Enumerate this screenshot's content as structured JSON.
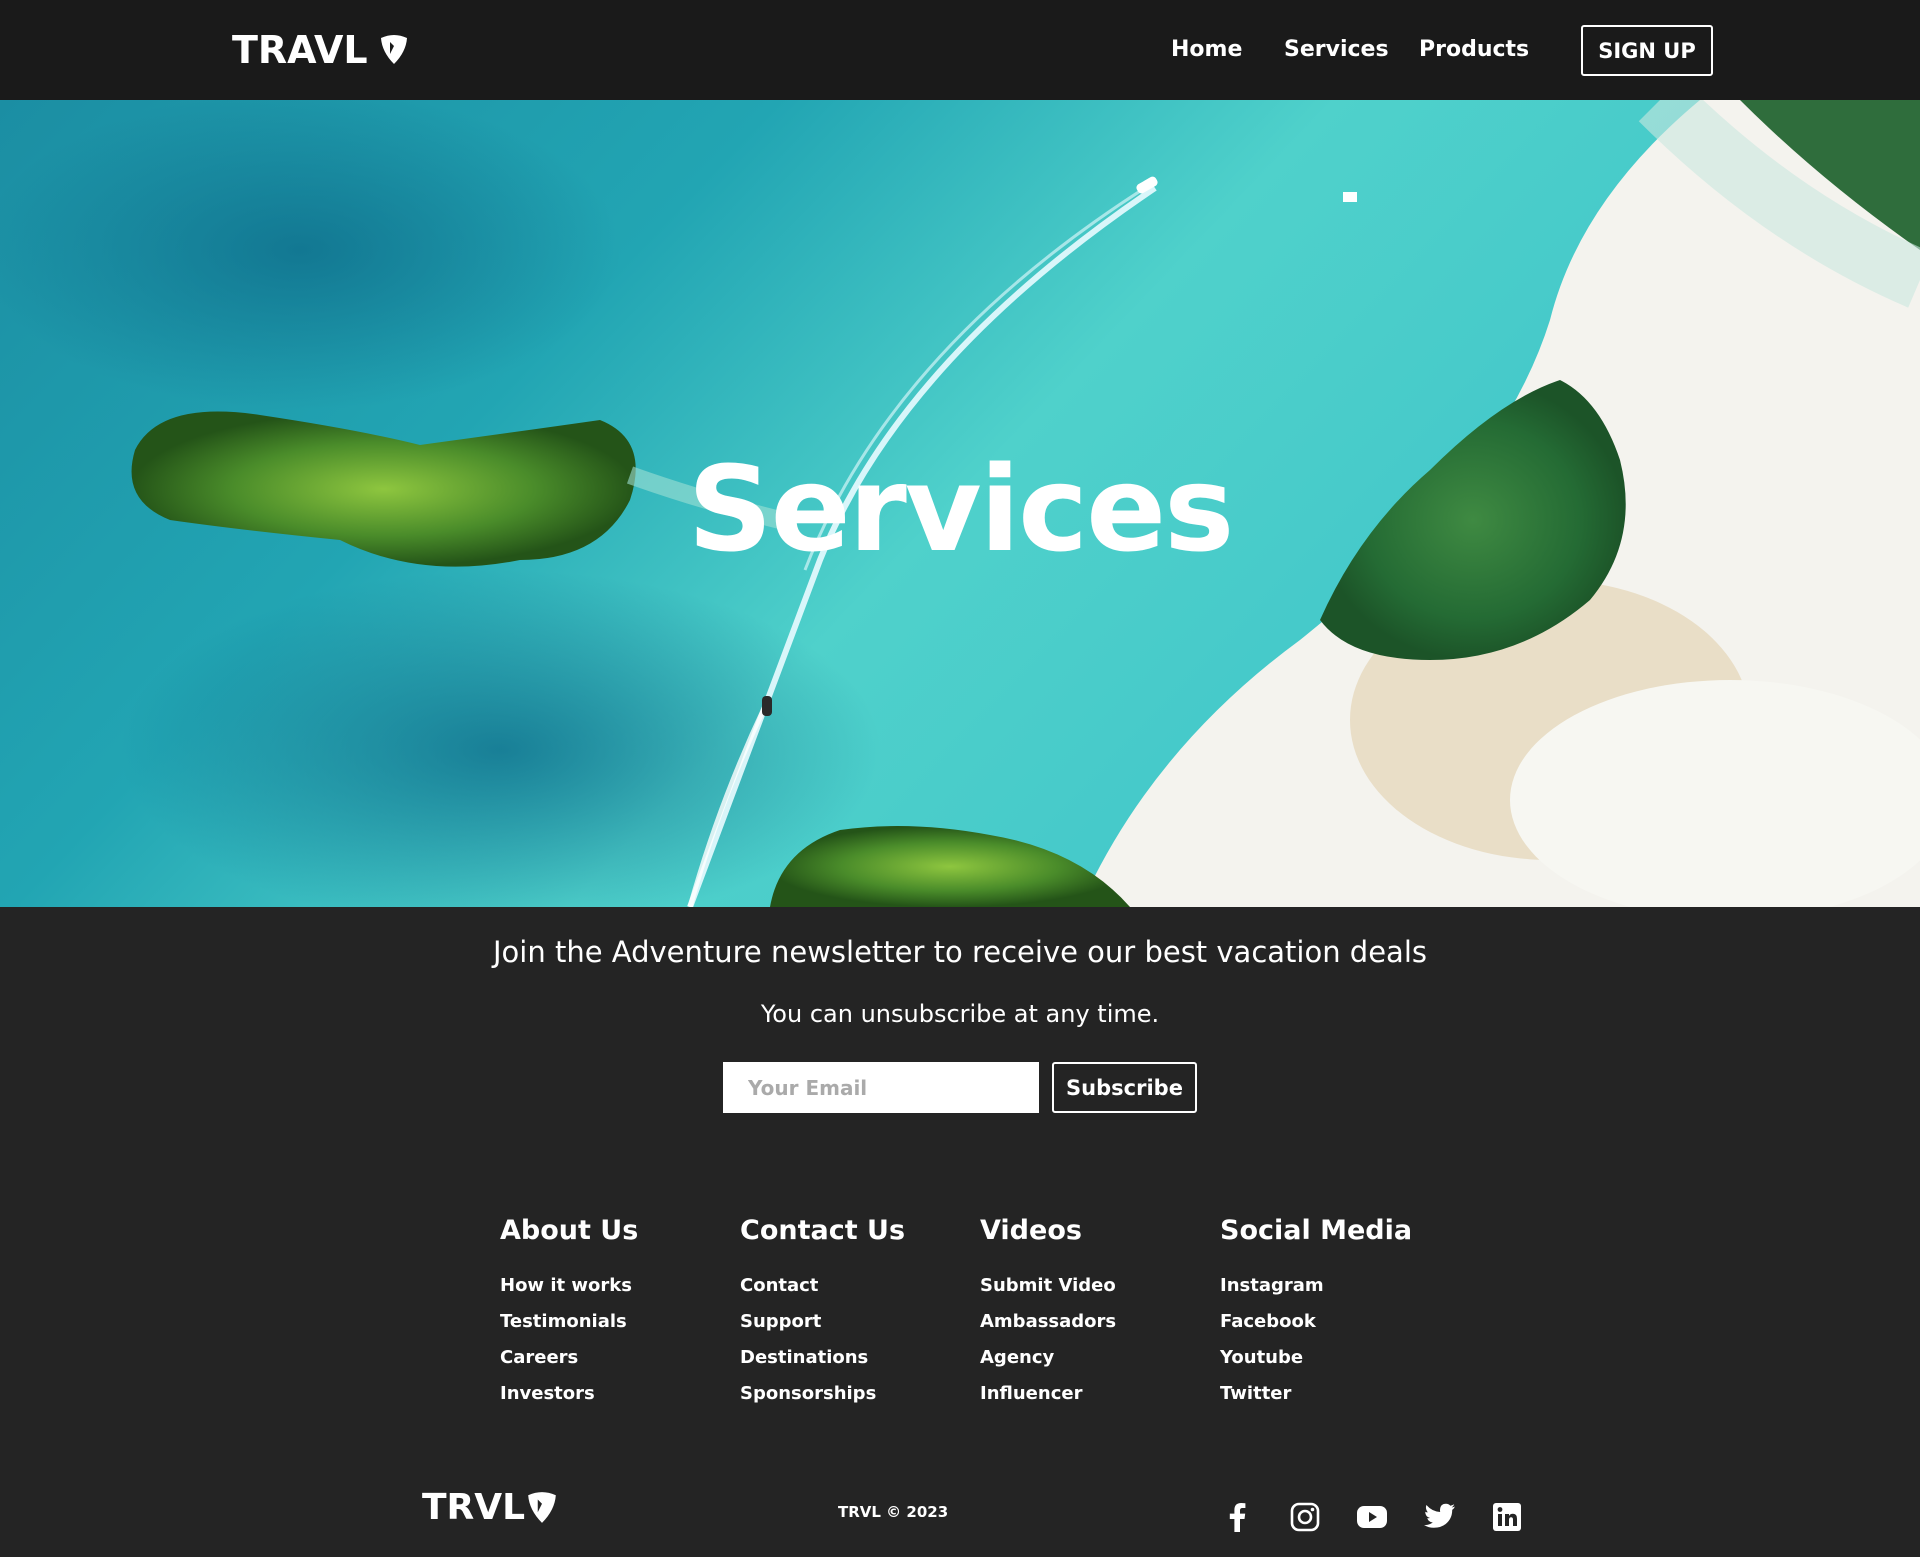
{
  "navbar": {
    "logo": "TRAVL",
    "links": [
      "Home",
      "Services",
      "Products"
    ],
    "signup": "SIGN UP"
  },
  "hero": {
    "title": "Services"
  },
  "newsletter": {
    "heading": "Join the Adventure newsletter to receive our best vacation deals",
    "subtext": "You can unsubscribe at any time.",
    "email_placeholder": "Your Email",
    "subscribe": "Subscribe"
  },
  "footer": {
    "columns": [
      {
        "title": "About Us",
        "links": [
          "How it works",
          "Testimonials",
          "Careers",
          "Investors"
        ]
      },
      {
        "title": "Contact Us",
        "links": [
          "Contact",
          "Support",
          "Destinations",
          "Sponsorships"
        ]
      },
      {
        "title": "Videos",
        "links": [
          "Submit Video",
          "Ambassadors",
          "Agency",
          "Influencer"
        ]
      },
      {
        "title": "Social Media",
        "links": [
          "Instagram",
          "Facebook",
          "Youtube",
          "Twitter"
        ]
      }
    ],
    "logo": "TRVL",
    "copyright": "TRVL © 2023",
    "social_icons": [
      "facebook-icon",
      "instagram-icon",
      "youtube-icon",
      "twitter-icon",
      "linkedin-icon"
    ]
  }
}
